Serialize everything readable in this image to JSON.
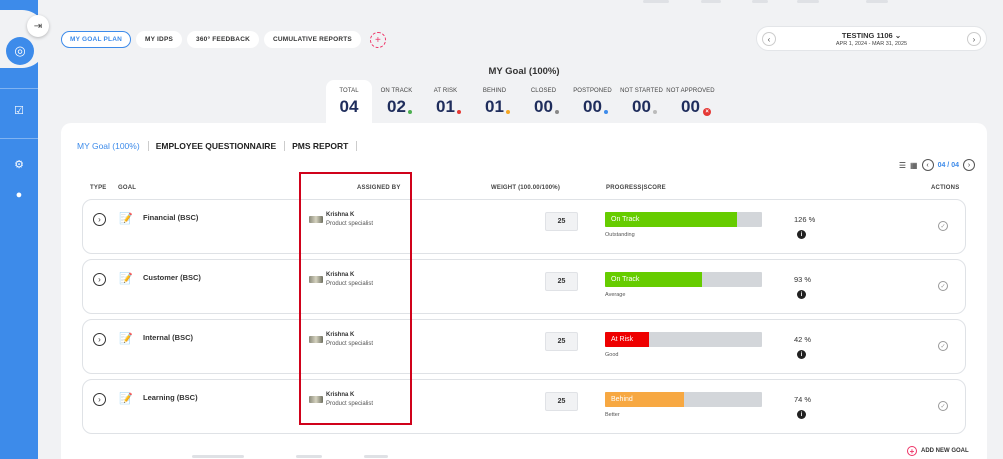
{
  "sidebar": {
    "collapse_icon": "collapse-arrow-icon",
    "items": [
      {
        "icon": "target-icon",
        "active": true
      },
      {
        "icon": "checklist-icon"
      },
      {
        "icon": "settings-gear-icon"
      },
      {
        "icon": "user-icon"
      }
    ]
  },
  "tabs": [
    {
      "label": "MY GOAL PLAN",
      "active": true
    },
    {
      "label": "MY IDPS"
    },
    {
      "label": "360° FEEDBACK"
    },
    {
      "label": "CUMULATIVE REPORTS"
    }
  ],
  "tab_add": "+",
  "cycle": {
    "prev": "‹",
    "next": "›",
    "name": "TESTING 1106",
    "dates": "APR 1, 2024 - MAR 31, 2025"
  },
  "goal_title": "MY Goal (100%)",
  "stats": [
    {
      "label": "TOTAL",
      "value": "04"
    },
    {
      "label": "ON TRACK",
      "value": "02",
      "color": "#4caf50"
    },
    {
      "label": "AT RISK",
      "value": "01",
      "color": "#e53935"
    },
    {
      "label": "BEHIND",
      "value": "01",
      "color": "#f5a623"
    },
    {
      "label": "CLOSED",
      "value": "00",
      "color": "#888888"
    },
    {
      "label": "POSTPONED",
      "value": "00",
      "color": "#3d8bea"
    },
    {
      "label": "NOT STARTED",
      "value": "00",
      "color": "#bbbbbb"
    },
    {
      "label": "NOT APPROVED",
      "value": "00",
      "color": "#e53935"
    }
  ],
  "subtabs": [
    {
      "label": "MY Goal (100%)",
      "active": true
    },
    {
      "label": "EMPLOYEE QUESTIONNAIRE"
    },
    {
      "label": "PMS REPORT"
    }
  ],
  "pager": {
    "current": "04 / 04",
    "prev": "‹",
    "next": "›"
  },
  "table": {
    "headers": {
      "type": "TYPE",
      "goal": "GOAL",
      "assigned_by": "ASSIGNED BY",
      "weight": "WEIGHT (100.00/100%)",
      "progress": "PROGRESS|SCORE",
      "actions": "ACTIONS"
    },
    "rows": [
      {
        "goal": "Financial (BSC)",
        "assigner": "Krishna K",
        "role": "Product specialist",
        "weight": "25",
        "status": "On Track",
        "status_color": "#66cc00",
        "progress": 0.84,
        "rating": "Outstanding",
        "score": "126 %"
      },
      {
        "goal": "Customer (BSC)",
        "assigner": "Krishna K",
        "role": "Product specialist",
        "weight": "25",
        "status": "On Track",
        "status_color": "#66cc00",
        "progress": 0.62,
        "rating": "Average",
        "score": "93 %"
      },
      {
        "goal": "Internal (BSC)",
        "assigner": "Krishna K",
        "role": "Product specialist",
        "weight": "25",
        "status": "At Risk",
        "status_color": "#ee0000",
        "progress": 0.28,
        "rating": "Good",
        "score": "42 %"
      },
      {
        "goal": "Learning (BSC)",
        "assigner": "Krishna K",
        "role": "Product specialist",
        "weight": "25",
        "status": "Behind",
        "status_color": "#f7a842",
        "progress": 0.5,
        "rating": "Better",
        "score": "74 %"
      }
    ]
  },
  "add_goal": "ADD NEW GOAL"
}
